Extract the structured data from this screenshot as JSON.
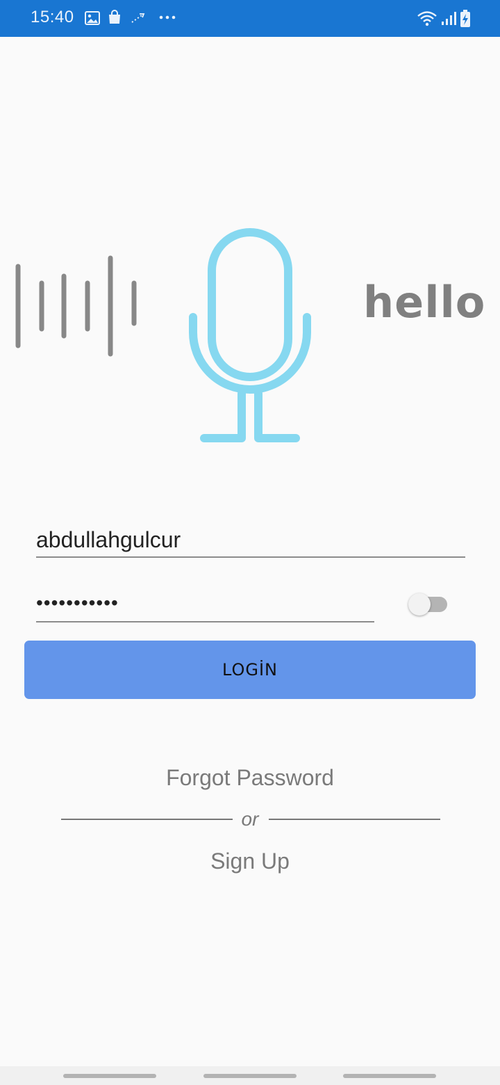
{
  "status_bar": {
    "time": "15:40",
    "left_icons": [
      "image-icon",
      "shopping-bag-icon",
      "sync-icon",
      "more-dots-icon"
    ],
    "right_icons": [
      "wifi-icon",
      "signal-icon",
      "battery-charging-icon"
    ]
  },
  "hero": {
    "logo_text": "hello",
    "icons": [
      "sound-wave-icon",
      "microphone-icon"
    ],
    "mic_color": "#86d8f0",
    "wave_color": "#888888"
  },
  "login_form": {
    "username_value": "abdullahgulcur",
    "password_masked": "•••••••••••",
    "show_password_toggle": false,
    "login_button_label": "LOGİN",
    "accent_color": "#6395ea"
  },
  "links": {
    "forgot_password": "Forgot Password",
    "or": "or",
    "sign_up": "Sign Up"
  }
}
